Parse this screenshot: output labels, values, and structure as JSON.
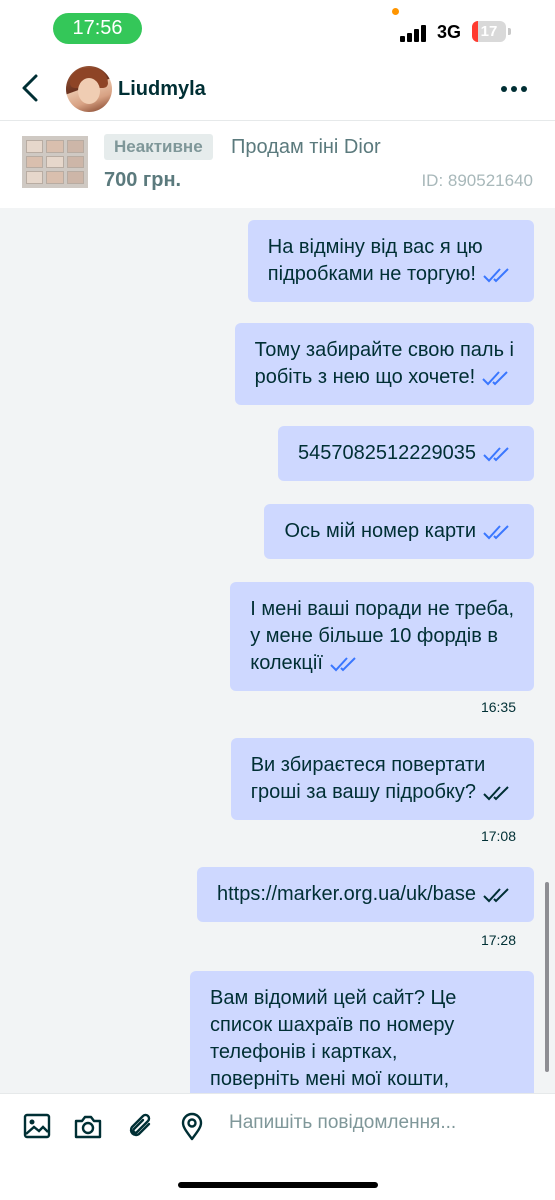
{
  "status_bar": {
    "time": "17:56",
    "network": "3G",
    "battery": "17",
    "battery_level": 0.17
  },
  "header": {
    "contact_name": "Liudmyla"
  },
  "listing": {
    "status": "Неактивне",
    "title": "Продам тіні Dior",
    "price": "700 грн.",
    "id": "ID: 890521640"
  },
  "messages": [
    {
      "text": "На відміну від вас я цю\nпідробками не торгую!",
      "read": true
    },
    {
      "text": "Тому забирайте свою паль і\nробіть з нею що хочете!",
      "read": true
    },
    {
      "text": "5457082512229035",
      "read": true
    },
    {
      "text": "Ось мій номер карти",
      "read": true
    },
    {
      "text": "І мені ваші поради не треба,\nу мене більше 10 фордів в\nколекції",
      "read": true,
      "time": "16:35"
    },
    {
      "text": "Ви збираєтеся повертати\nгроші за вашу підробку?",
      "read": false,
      "time": "17:08"
    },
    {
      "text": "https://marker.org.ua/uk/base",
      "read": false,
      "time": "17:28"
    },
    {
      "text": "Вам відомий цей сайт? Це\nсписок шахраїв по номеру\nтелефонів і картках,\nповерніть мені мої кошти,",
      "read": false
    }
  ],
  "input": {
    "placeholder": "Напишіть повідомлення..."
  },
  "colors": {
    "bubble": "#ced8ff",
    "read_check": "#3a77ff",
    "chat_bg": "#f2f4f5",
    "text": "#002f34"
  },
  "icons": [
    "back-arrow-icon",
    "more-dots-icon",
    "image-icon",
    "camera-icon",
    "paperclip-icon",
    "location-pin-icon",
    "double-check-icon"
  ]
}
